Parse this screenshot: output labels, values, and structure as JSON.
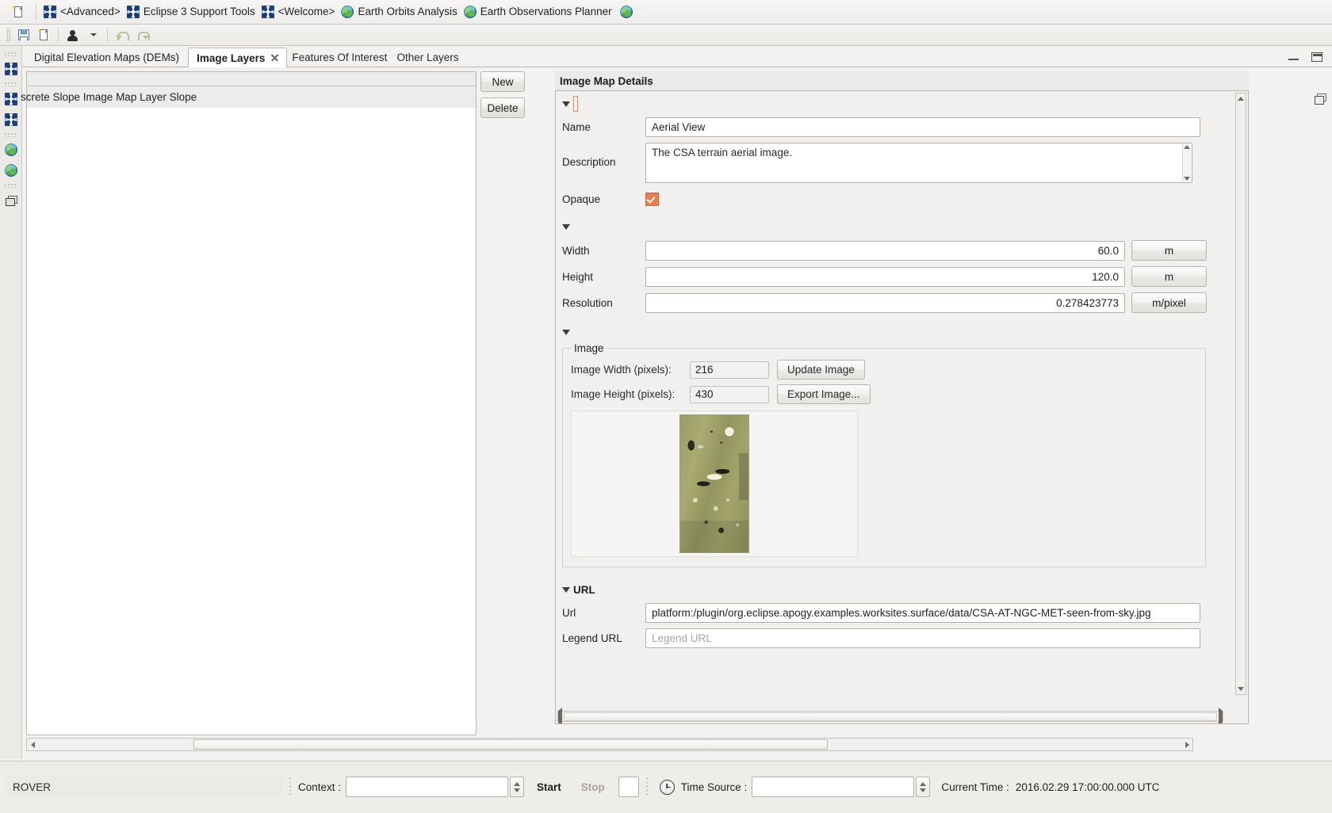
{
  "window": {
    "perspective_bar": {
      "new_button_icon": "new-wizard-icon",
      "items": [
        {
          "label": "<Advanced>",
          "icon": "eclipse-perspective-icon"
        },
        {
          "label": "Eclipse 3 Support Tools",
          "icon": "eclipse-perspective-icon"
        },
        {
          "label": "<Welcome>",
          "icon": "eclipse-perspective-icon"
        },
        {
          "label": "Earth Orbits Analysis",
          "icon": "globe-icon"
        },
        {
          "label": "Earth Observations Planner",
          "icon": "globe-icon"
        }
      ],
      "trailing_icon": "globe-icon"
    },
    "toolbar": {
      "save_icon": "save-icon",
      "new_icon": "new-wizard-icon",
      "person_icon": "person-icon",
      "dropdown_icon": "chevron-down-icon",
      "undo_icon": "undo-icon",
      "redo_icon": "redo-icon"
    },
    "fastview_bar": {
      "items": [
        {
          "icon": "eclipse-perspective-icon"
        },
        {
          "icon": "eclipse-perspective-icon"
        },
        {
          "icon": "eclipse-perspective-icon"
        },
        {
          "icon": "globe-icon"
        },
        {
          "icon": "globe-icon"
        },
        {
          "icon": "restore-view-icon"
        }
      ]
    }
  },
  "editor": {
    "tabs": [
      {
        "label": "Digital Elevation Maps (DEMs)",
        "active": false
      },
      {
        "label": "Image Layers",
        "active": true
      },
      {
        "label": "Features Of Interest",
        "active": false
      },
      {
        "label": "Other Layers",
        "active": false
      }
    ],
    "minimize_icon": "minimize-icon",
    "maximize_icon": "maximize-icon",
    "restore_icon": "restore-icon"
  },
  "list_panel": {
    "rows": [
      {
        "label": "screte Slope Image Map Layer Slope"
      }
    ],
    "buttons": {
      "new": "New",
      "delete": "Delete"
    }
  },
  "details": {
    "title": "Image Map Details",
    "general": {
      "name_label": "Name",
      "name_value": "Aerial View",
      "description_label": "Description",
      "description_value": "The CSA terrain aerial image.",
      "opaque_label": "Opaque",
      "opaque_checked": true,
      "accent_color": "#ea7f4b"
    },
    "dimensions": {
      "width_label": "Width",
      "width_value": "60.0",
      "width_unit": "m",
      "height_label": "Height",
      "height_value": "120.0",
      "height_unit": "m",
      "resolution_label": "Resolution",
      "resolution_value": "0.278423773",
      "resolution_unit": "m/pixel"
    },
    "image_group": {
      "group_title": "Image",
      "image_width_label": "Image Width (pixels):",
      "image_width_value": "216",
      "image_height_label": "Image Height (pixels):",
      "image_height_value": "430",
      "update_button": "Update Image",
      "export_button": "Export Image...",
      "preview_alt": "aerial-terrain-thumbnail"
    },
    "url_section": {
      "section_label": "URL",
      "url_label": "Url",
      "url_value": "platform:/plugin/org.eclipse.apogy.examples.worksites.surface/data/CSA-AT-NGC-MET-seen-from-sky.jpg",
      "legend_label": "Legend URL",
      "legend_placeholder": "Legend URL",
      "legend_value": ""
    }
  },
  "status_bar": {
    "rover_label": "ROVER",
    "context_label": "Context :",
    "context_value": "",
    "start_button": "Start",
    "stop_button": "Stop",
    "time_source_label": "Time Source :",
    "time_source_value": "",
    "current_time_label": "Current Time :",
    "current_time_value": "2016.02.29 17:00:00.000 UTC",
    "clock_icon": "clock-icon"
  }
}
